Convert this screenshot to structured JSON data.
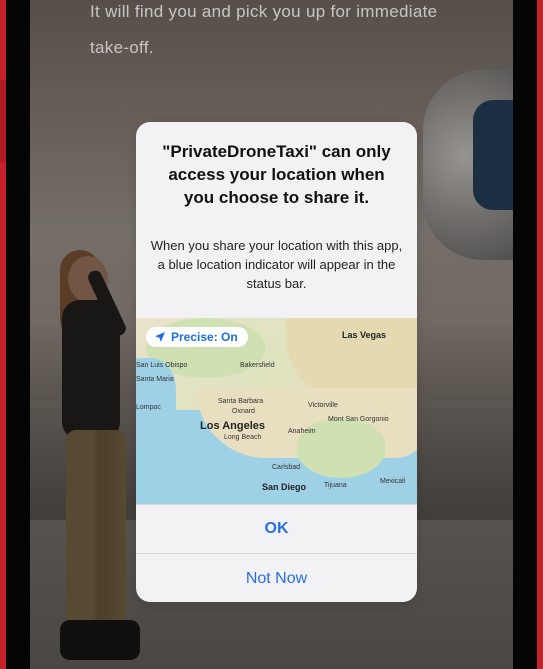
{
  "background": {
    "intro_text": "It will find you and pick you up for immediate take-off."
  },
  "alert": {
    "title": "\"PrivateDroneTaxi\" can only access your location when you choose to share it.",
    "message": "When you share your location with this app, a blue location indicator will appear in the status bar.",
    "precise_label": "Precise: On",
    "ok_label": "OK",
    "not_now_label": "Not Now"
  },
  "map": {
    "labels": [
      "Las Vegas",
      "San Luis Obispo",
      "Bakersfield",
      "Santa Maria",
      "Lompoc",
      "Santa Barbara",
      "Oxnard",
      "Victorville",
      "Mont San Gorgonio",
      "Los Angeles",
      "Long Beach",
      "Anaheim",
      "Carlsbad",
      "San Diego",
      "Tijuana",
      "Mexicali"
    ]
  },
  "colors": {
    "accent": "#2870e0",
    "device_red": "#c8202a",
    "alert_bg": "#f2f2f4"
  }
}
